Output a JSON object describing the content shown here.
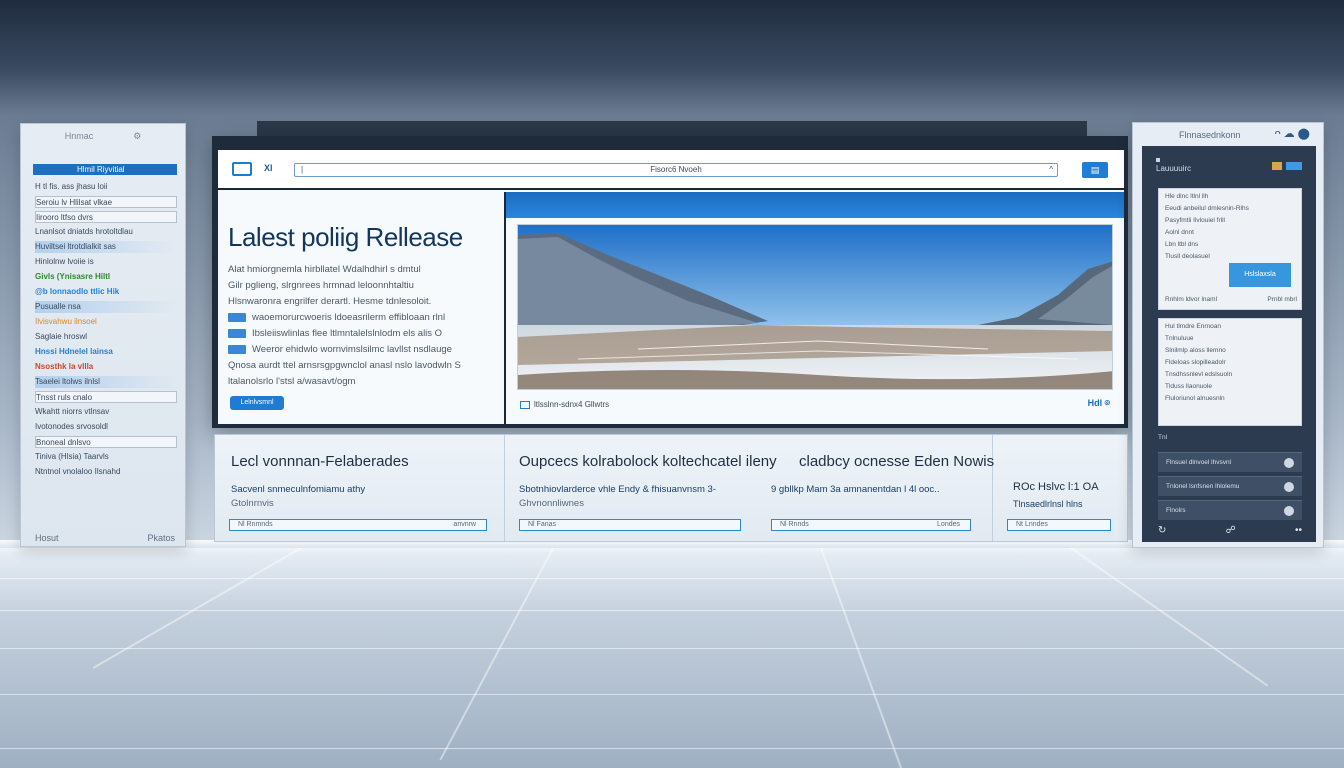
{
  "left_panel": {
    "header_label": "Hnmac",
    "header_icon": "gear-icon",
    "active_item": "Hlmil Riyvitial",
    "rows": [
      "H tl fis. ass jhasu loii",
      "Seroiu lv    Hlilsat   vlkae",
      "Iirooro ltfso dvrs",
      "Lnanlsot dniatds hrotoltdlau",
      "Huviltsei ltrotdlalkit sas",
      "Hinlolnw lvoiie is",
      "Givls (Ynisasre Hiltl",
      "@b lonnaodlo ttlic Hik",
      "Pusualle nsa",
      "Ilvisvahwu ilnsoel",
      "Saglaie hroswl",
      "Hnssi Hdnelel lainsa",
      "Nsosthk la vllla",
      "Tsaelei ltolws ilnlsl",
      "Tnsst ruls cnalo",
      "Wkahtt niorrs vtlnsav",
      "Ivotonodes srvosoldl",
      "Bnoneal dnlsvo",
      "Tiniva (Hlsia) Taarvls",
      "Ntntnol vnolaloo Ilsnahd"
    ],
    "footer_left": "Hosut",
    "footer_right": "Pkatos"
  },
  "browser": {
    "left_icon": "image-icon",
    "left_text": "Xl",
    "url_text": "Fisorc6  Nvoeh",
    "url_chevron": "^",
    "action_icon": "bookmark-icon"
  },
  "article": {
    "title": "Lalest poliig Rellease",
    "lines": [
      "Alat hmiorgnemla hirbllatel Wdalhdhirl s dmtul",
      "Gilr pglieng, slrgnrees hrmnad leloonnhtaltiu",
      "Hlsnwaronra engrilfer derartl. Hesme tdnlesoloit.",
      "waoemorurcwoeris ldoeasrilerm effibloaan rlnl",
      "Ibsleiiswlinlas flee  ltlmntalelslnlodm els alis O",
      "Weeror ehidwlo wornvimslsilmc lavllst nsdlauge",
      "Qnosa aurdt ttel arnsrsgpgwnclol anasl nslo lavodwln S",
      "ltalanolsrlo l'stsl a/wasavt/ogm"
    ],
    "read_more": "Lelnlvsmnl"
  },
  "media": {
    "caption": "ltlsslnn-sdnx4 Gllwtrs",
    "tools": "Hdl"
  },
  "news": [
    {
      "title": "Lecl vonnnan-Felaberades",
      "sub1": "Sacvenl snmeculnfomiamu athy",
      "sub2": "Gtolnrnvis",
      "input_left": "Nl  Rnmnds",
      "input_right": "anvnrw"
    },
    {
      "title": "Oupcecs kolrabolock koltechcatel ileny",
      "sub1": "Sbotnhiovlarderce vhle Endy & fhisuanvnsm 3-",
      "sub2": "Ghvnonnliwnes",
      "input_left": "Nl  Fanas",
      "input_right": ""
    },
    {
      "title": "cladbcy ocnesse Eden Nowis",
      "sub1": "9 gbllkp Mam 3a amnanentdan l 4l ooc..",
      "sub2": "",
      "input_left": "Nl  Rnnds",
      "input_right": "Londes"
    },
    {
      "title": "ROc Hslvc l:1 OA",
      "sub1": "Tlnsaedlrlnsl hlns",
      "sub2": "",
      "input_left": "Nt  Lnndes",
      "input_right": ""
    }
  ],
  "right_panel": {
    "header_label": "Flnnasednkonn",
    "header_icons": "ᴖ☁⬤",
    "title": "Lauuuuirc",
    "card1_lines": [
      "Hle dlnc ltlnl llh",
      "Eeudi anbeilul dmlesnin-Rlhs",
      "Pasyfmtli Ilvlouiel frlll",
      "Aolnl dnnt",
      "Lbn ltbl dns",
      "Tlusll deolasuel"
    ],
    "card1_button": "Hslslaxsla",
    "card1_footer_left": "Rnhlm ldvor lnaml",
    "card1_footer_right": "Prnbl mbrl",
    "card2_lines": [
      "Hul tlmdre   Enrnoan",
      "Tnlnuluue",
      "Slnilmlp aloss llemno",
      "Fldeloas slopilleadolr",
      "Tnsdhssnlevl edslsuoln",
      "Tlduss llaonuole",
      "Fluloriunol alnuesnln"
    ],
    "label": "Tnl",
    "dark_rows": [
      "Flnsuel dlnvoel lhvsvnl",
      "Tnlonel lsnfsnen lhlolemu",
      "Flnolrs"
    ],
    "footer_icons": [
      "↻",
      "☍",
      "••"
    ]
  }
}
